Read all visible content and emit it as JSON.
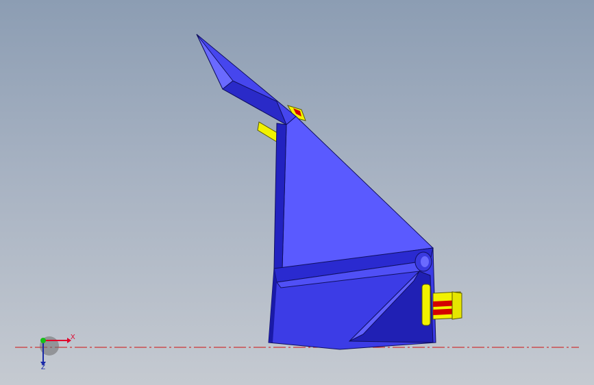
{
  "viewport": {
    "background_top": "#8c9db3",
    "background_bottom": "#c5cad1"
  },
  "model": {
    "body_color": "#3c3ce6",
    "body_highlight": "#5a5aff",
    "body_shadow": "#1a1aa8",
    "fastener_color": "#f2f200",
    "accent_color": "#d40000"
  },
  "triad": {
    "x_label": "X",
    "z_label": "Z",
    "x_color": "#e0002a",
    "y_color": "#16c016",
    "z_color": "#1a2aa8"
  },
  "centerline": {
    "color": "#d01010"
  }
}
